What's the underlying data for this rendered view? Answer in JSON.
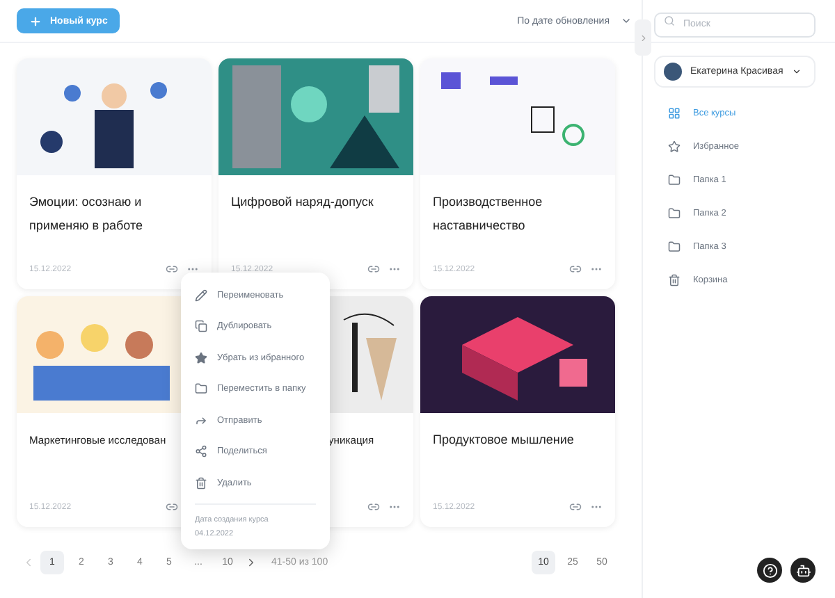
{
  "header": {
    "new_button": "Новый курс",
    "sort": "По дате обновления",
    "search": {
      "placeholder": "Поиск"
    }
  },
  "cards": [
    {
      "title": "Эмоции: осознаю и применяю в работе",
      "date": "15.12.2022",
      "kind": "people",
      "menu": {
        "items": [
          {
            "label": "Переименовать",
            "kind": "rename"
          },
          {
            "label": "Дублировать",
            "kind": "duplicate"
          },
          {
            "label": "Убрать из ибранного",
            "kind": "unfavorite"
          },
          {
            "label": "Переместить в папку",
            "kind": "move"
          },
          {
            "label": "Отправить",
            "kind": "send"
          },
          {
            "label": "Поделиться",
            "kind": "share"
          },
          {
            "label": "Удалить",
            "kind": "delete"
          }
        ],
        "created_label": "Дата создания курса",
        "created_date": "04.12.2022"
      }
    },
    {
      "title": "Цифровой наряд-допуск",
      "date": "15.12.2022",
      "kind": "geometric"
    },
    {
      "title": "Производственное наставничество",
      "date": "15.12.2022",
      "kind": "doodles"
    },
    {
      "title": "Маркетинговые исследован",
      "date": "15.12.2022",
      "kind": "crowd"
    },
    {
      "title": "уникация",
      "kind": "tools"
    },
    {
      "title": "Продуктовое мышление",
      "date": "15.12.2022",
      "kind": "isometric"
    }
  ],
  "pagination": {
    "pages": [
      {
        "label": "1",
        "selected": true
      },
      {
        "label": "2",
        "selected": false
      },
      {
        "label": "3",
        "selected": false
      },
      {
        "label": "4",
        "selected": false
      },
      {
        "label": "5",
        "selected": false
      },
      {
        "label": "...",
        "selected": false
      },
      {
        "label": "10",
        "selected": false
      }
    ],
    "range": "41-50 из 100",
    "page_sizes": [
      {
        "label": "10",
        "selected": true
      },
      {
        "label": "25",
        "selected": false
      },
      {
        "label": "50",
        "selected": false
      }
    ]
  },
  "sidebar": {
    "user": "Екатерина Красивая",
    "items": [
      {
        "label": "Все курсы",
        "kind": "all",
        "selected": true
      },
      {
        "label": "Избранное",
        "kind": "favorites",
        "selected": false
      },
      {
        "label": "Папка 1",
        "kind": "folder",
        "selected": false
      },
      {
        "label": "Папка 2",
        "kind": "folder",
        "selected": false
      },
      {
        "label": "Папка 3",
        "kind": "folder",
        "selected": false
      },
      {
        "label": "Корзина",
        "kind": "trash",
        "selected": false
      }
    ]
  }
}
